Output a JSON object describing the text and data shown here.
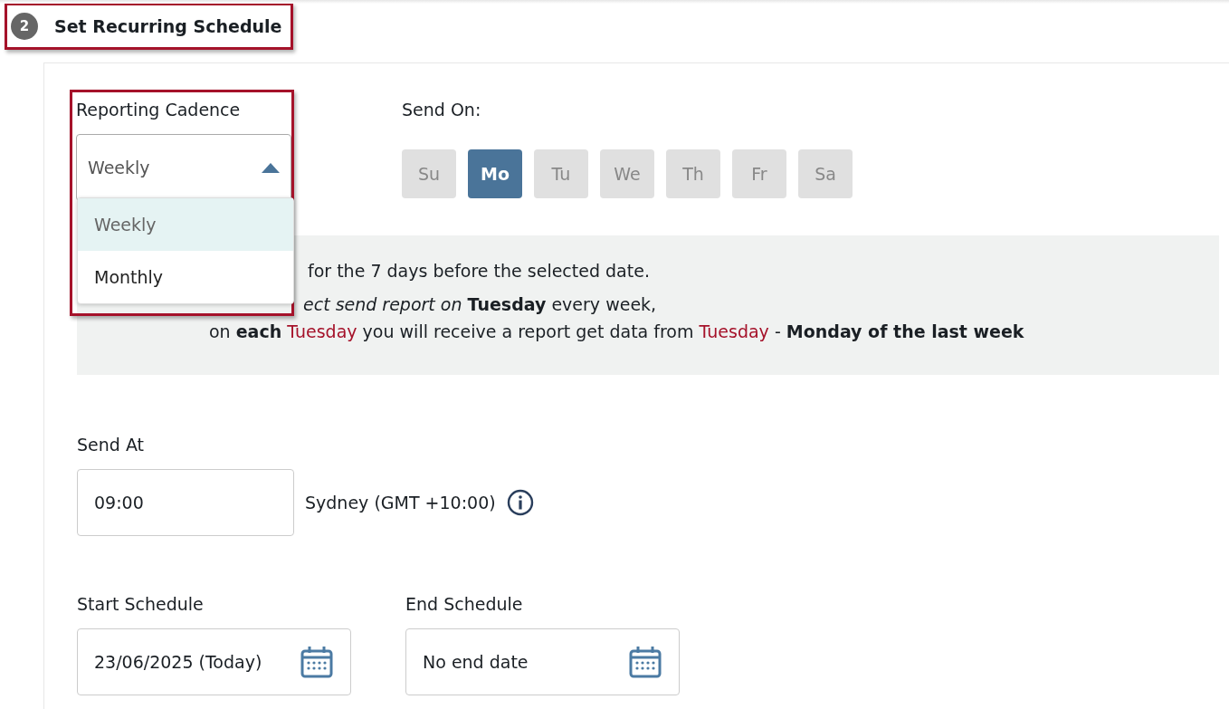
{
  "step": {
    "number": "2",
    "title": "Set Recurring Schedule",
    "highlighted": true
  },
  "cadence": {
    "label": "Reporting Cadence",
    "value": "Weekly",
    "expanded": true,
    "highlighted": true,
    "options": [
      {
        "label": "Weekly",
        "selected": true
      },
      {
        "label": "Monthly",
        "selected": false
      }
    ]
  },
  "send_on": {
    "label": "Send On:",
    "days": [
      {
        "label": "Su",
        "selected": false
      },
      {
        "label": "Mo",
        "selected": true
      },
      {
        "label": "Tu",
        "selected": false
      },
      {
        "label": "We",
        "selected": false
      },
      {
        "label": "Th",
        "selected": false
      },
      {
        "label": "Fr",
        "selected": false
      },
      {
        "label": "Sa",
        "selected": false
      }
    ]
  },
  "info": {
    "lines": [
      [
        {
          "text": "for the 7 days before the selected date.",
          "kind": "plain"
        }
      ],
      [
        {
          "text": "*ect send report on* **Tuesday** every week,",
          "kind": "plain"
        }
      ],
      [
        {
          "text": "on **each** ",
          "kind": "plain"
        },
        {
          "text": "Tuesday",
          "kind": "highlight"
        },
        {
          "text": " you will receive a report get data from ",
          "kind": "plain"
        },
        {
          "text": "Tuesday",
          "kind": "highlight"
        },
        {
          "text": " - **Monday of the last week**",
          "kind": "plain"
        }
      ]
    ]
  },
  "send_at": {
    "label": "Send At",
    "value": "09:00",
    "timezone": "Sydney (GMT +10:00)"
  },
  "start_schedule": {
    "label": "Start Schedule",
    "value": "23/06/2025 (Today)"
  },
  "end_schedule": {
    "label": "End Schedule",
    "value": "No end date"
  }
}
